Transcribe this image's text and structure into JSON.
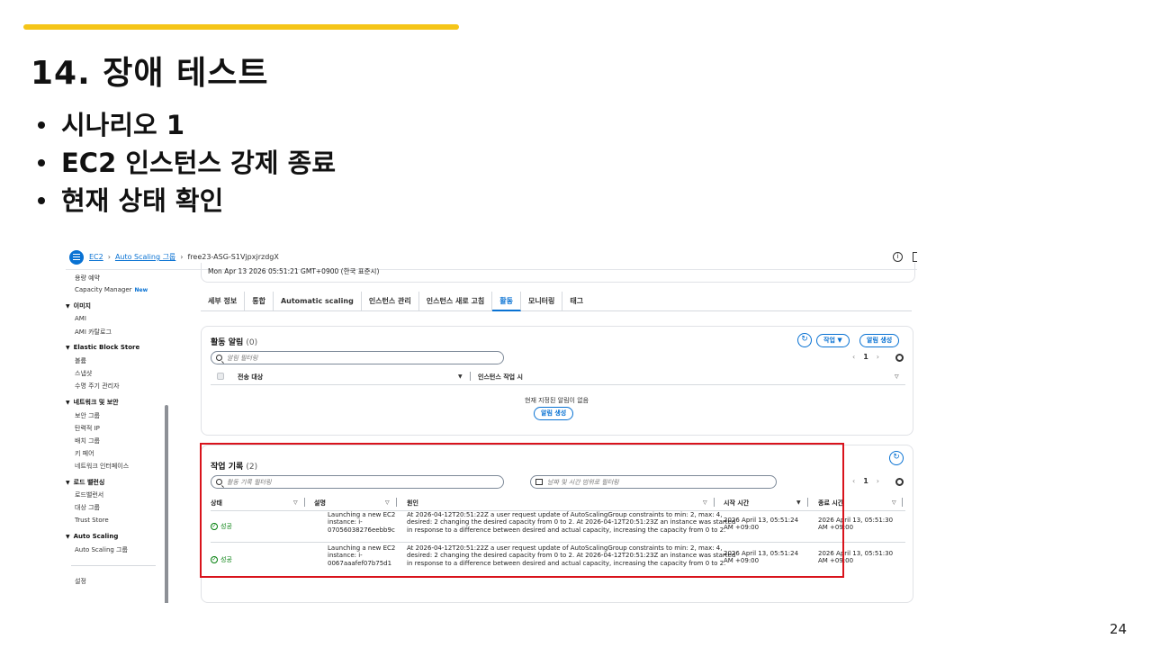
{
  "slide": {
    "title": "14. 장애 테스트",
    "bullets": [
      "시나리오 1",
      "EC2 인스턴스 강제 종료",
      "현재 상태 확인"
    ],
    "page_number": "24",
    "accent_color": "#f5c518",
    "highlight_color": "#d9131c"
  },
  "console": {
    "breadcrumb": [
      "EC2",
      "Auto Scaling 그룹",
      "free23-ASG-S1VjpxjrzdgX"
    ],
    "date_line": "Mon Apr 13 2026 05:51:21 GMT+0900 (한국 표준시)",
    "sidebar": {
      "items_top": [
        "용량 예약",
        "Capacity Manager"
      ],
      "new_badge": "New",
      "sections": [
        {
          "title": "이미지",
          "items": [
            "AMI",
            "AMI 카탈로그"
          ]
        },
        {
          "title": "Elastic Block Store",
          "items": [
            "볼륨",
            "스냅샷",
            "수명 주기 관리자"
          ]
        },
        {
          "title": "네트워크 및 보안",
          "items": [
            "보안 그룹",
            "탄력적 IP",
            "배치 그룹",
            "키 페어",
            "네트워크 인터페이스"
          ]
        },
        {
          "title": "로드 밸런싱",
          "items": [
            "로드밸런서",
            "대상 그룹",
            "Trust Store"
          ]
        },
        {
          "title": "Auto Scaling",
          "items": [
            "Auto Scaling 그룹"
          ]
        }
      ],
      "settings": "설정"
    },
    "tabs": [
      "세부 정보",
      "통합",
      "Automatic scaling",
      "인스턴스 관리",
      "인스턴스 새로 고침",
      "활동",
      "모니터링",
      "태그"
    ],
    "active_tab": "활동",
    "notifications": {
      "title": "활동 알림",
      "count": "(0)",
      "search_placeholder": "알림 필터링",
      "actions_button": "작업 ▼",
      "create_button": "알림 생성",
      "page": "1",
      "columns": [
        "전송 대상",
        "인스턴스 작업 시"
      ],
      "empty_text": "현재 지정된 알림이 없음",
      "empty_button": "알림 생성"
    },
    "history": {
      "title": "작업 기록",
      "count": "(2)",
      "search_placeholder": "활동 기록 필터링",
      "date_placeholder": "날짜 및 시간 범위로 필터링",
      "page": "1",
      "columns": [
        "상태",
        "설명",
        "원인",
        "시작 시간",
        "종료 시간"
      ],
      "rows": [
        {
          "status": "성공",
          "description_1": "Launching a new EC2",
          "description_2": "instance: i-",
          "description_3": "07056038276eebb9c",
          "cause_1": "At 2026-04-12T20:51:22Z a user request update of AutoScalingGroup constraints to min: 2, max: 4,",
          "cause_2": "desired: 2 changing the desired capacity from 0 to 2. At 2026-04-12T20:51:23Z an instance was started",
          "cause_3": "in response to a difference between desired and actual capacity, increasing the capacity from 0 to 2.",
          "start_1": "2026 April 13, 05:51:24",
          "start_2": "AM +09:00",
          "end_1": "2026 April 13, 05:51:30",
          "end_2": "AM +09:00"
        },
        {
          "status": "성공",
          "description_1": "Launching a new EC2",
          "description_2": "instance: i-",
          "description_3": "0067aaafef07b75d1",
          "cause_1": "At 2026-04-12T20:51:22Z a user request update of AutoScalingGroup constraints to min: 2, max: 4,",
          "cause_2": "desired: 2 changing the desired capacity from 0 to 2. At 2026-04-12T20:51:23Z an instance was started",
          "cause_3": "in response to a difference between desired and actual capacity, increasing the capacity from 0 to 2.",
          "start_1": "2026 April 13, 05:51:24",
          "start_2": "AM +09:00",
          "end_1": "2026 April 13, 05:51:30",
          "end_2": "AM +09:00"
        }
      ]
    }
  }
}
